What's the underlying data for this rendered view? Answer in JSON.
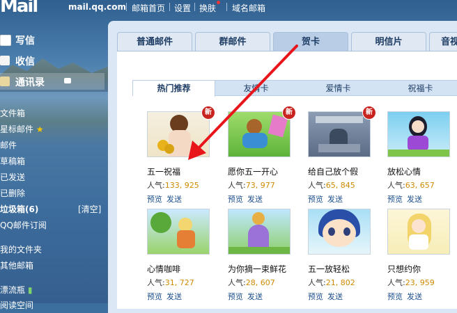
{
  "top": {
    "logo": "Mail",
    "domain": "mail.qq.com",
    "links": [
      "邮箱首页",
      "设置",
      "换肤",
      "域名邮箱"
    ]
  },
  "sidebar": {
    "write": "写信",
    "inbox": "收信",
    "contacts": "通讯录",
    "folders": [
      "文件箱",
      "星标邮件",
      "邮件",
      "草稿箱",
      "已发送",
      "已删除",
      "垃圾箱(6)",
      "QQ邮件订阅",
      "我的文件夹",
      "其他邮箱",
      "漂流瓶",
      "阅读空间"
    ],
    "clear": "[清空]"
  },
  "tabs": [
    "普通邮件",
    "群邮件",
    "贺卡",
    "明信片",
    "音视"
  ],
  "active_tab": 2,
  "subtabs": [
    "热门推荐",
    "友情卡",
    "爱情卡",
    "祝福卡"
  ],
  "active_subtab": 0,
  "popularity_label": "人气:",
  "preview_label": "预览",
  "send_label": "发送",
  "new_label": "新",
  "cards": [
    {
      "title": "五一祝福",
      "pop": "133, 925",
      "is_new": true
    },
    {
      "title": "愿你五一开心",
      "pop": "73, 977",
      "is_new": true
    },
    {
      "title": "给自己放个假",
      "pop": "65, 845",
      "is_new": true
    },
    {
      "title": "放松心情",
      "pop": "63, 657",
      "is_new": false
    },
    {
      "title": "心情咖啡",
      "pop": "31, 727",
      "is_new": false
    },
    {
      "title": "为你摘一束鲜花",
      "pop": "28, 607",
      "is_new": false
    },
    {
      "title": "五一放轻松",
      "pop": "21, 802",
      "is_new": false
    },
    {
      "title": "只想约你",
      "pop": "23, 959",
      "is_new": false
    }
  ],
  "colors": {
    "accent_arrow": "#e8151b",
    "tab_text": "#1d3c63",
    "popularity_value": "#d08a00",
    "link": "#1c4f8e"
  }
}
